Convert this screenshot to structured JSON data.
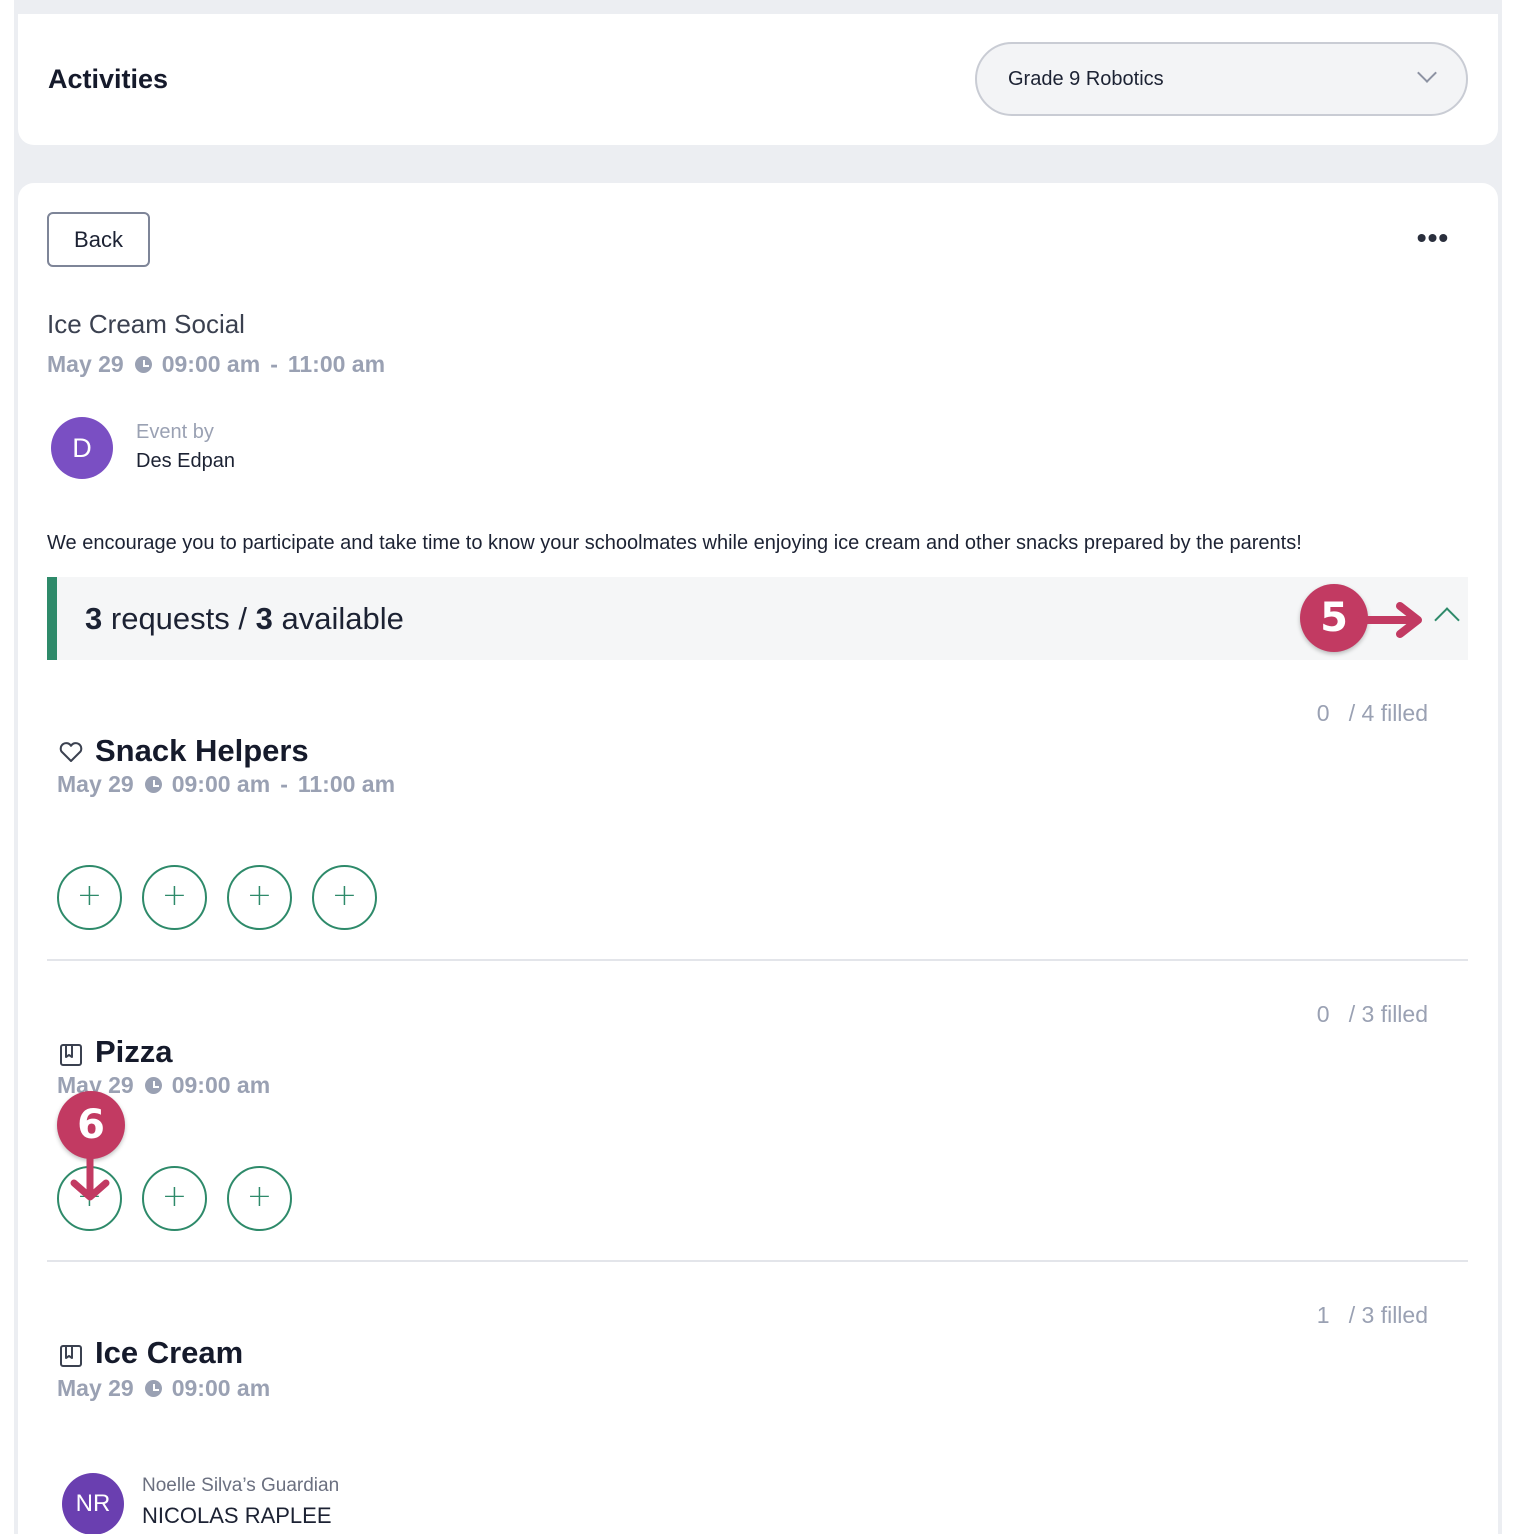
{
  "header": {
    "title": "Activities",
    "class_select": {
      "value": "Grade 9 Robotics"
    }
  },
  "event": {
    "back_label": "Back",
    "more_label": "•••",
    "title": "Ice Cream Social",
    "date": "May 29",
    "start_time": "09:00 am",
    "separator": "-",
    "end_time": "11:00 am",
    "author": {
      "caption": "Event by",
      "initial": "D",
      "name": "Des Edpan"
    },
    "description": "We encourage you to participate and take time to know your schoolmates while enjoying ice cream and other snacks prepared by the parents!"
  },
  "requests": {
    "requests_count": "3",
    "requests_label": "requests /",
    "available_count": "3",
    "available_label": "available"
  },
  "callouts": {
    "first": "5",
    "second": "6"
  },
  "slots": [
    {
      "name": "Snack Helpers",
      "icon": "heart-icon",
      "date": "May 29",
      "start_time": "09:00 am",
      "separator": "-",
      "end_time": "11:00 am",
      "filled_count": "0",
      "filled_label": "/ 4 filled",
      "add_label": "+",
      "open_spots": 4
    },
    {
      "name": "Pizza",
      "icon": "book-icon",
      "date": "May 29",
      "start_time": "09:00 am",
      "filled_count": "0",
      "filled_label": "/ 3 filled",
      "add_label": "+",
      "open_spots": 3
    },
    {
      "name": "Ice Cream",
      "icon": "book-icon",
      "date": "May 29",
      "start_time": "09:00 am",
      "filled_count": "1",
      "filled_label": "/ 3 filled",
      "volunteer": {
        "initials": "NR",
        "caption": "Noelle Silva’s Guardian",
        "name": "NICOLAS RAPLEE"
      }
    }
  ],
  "colors": {
    "accent": "#2e8a6a",
    "callout": "#c23a62",
    "author_avatar": "#7a4fc3",
    "muted_text": "#9aa1b3"
  }
}
